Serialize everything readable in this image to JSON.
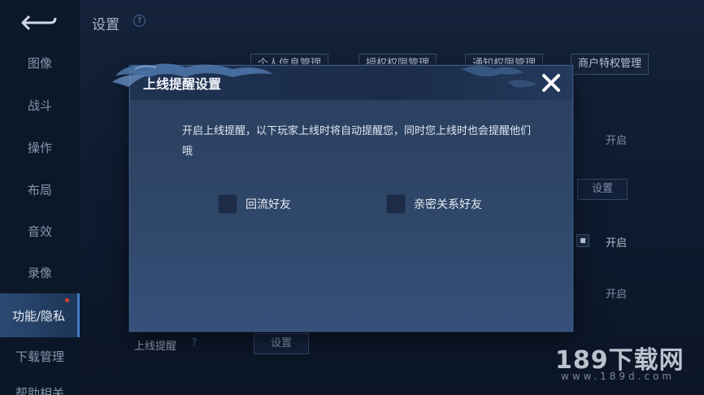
{
  "header": {
    "title": "设置",
    "help": "?"
  },
  "sidebar": {
    "items": [
      {
        "label": "图像"
      },
      {
        "label": "战斗"
      },
      {
        "label": "操作"
      },
      {
        "label": "布局"
      },
      {
        "label": "音效"
      },
      {
        "label": "录像"
      },
      {
        "label": "功能/隐私",
        "active": true
      },
      {
        "label": "下载管理"
      },
      {
        "label": "帮助相关"
      }
    ]
  },
  "top_tabs": [
    "个人信息管理",
    "授权权限管理",
    "通知权限管理",
    "商户特权管理"
  ],
  "background": {
    "open_1": "开启",
    "settings": "设置",
    "open_2": "开启",
    "open_3": "开启",
    "online_reminder_label": "上线提醒",
    "online_reminder_help": "?",
    "online_reminder_button": "设置"
  },
  "modal": {
    "title": "上线提醒设置",
    "description": "开启上线提醒，以下玩家上线时将自动提醒您，同时您上线时也会提醒他们哦",
    "options": [
      {
        "label": "回流好友",
        "checked": false
      },
      {
        "label": "亲密关系好友",
        "checked": false
      }
    ]
  },
  "watermark": {
    "main": "189下载网",
    "sub": "www.189d.com"
  },
  "colors": {
    "accent": "#3f7cc4",
    "modal_bg": "#2f4768",
    "page_bg": "#0e1a2e"
  }
}
